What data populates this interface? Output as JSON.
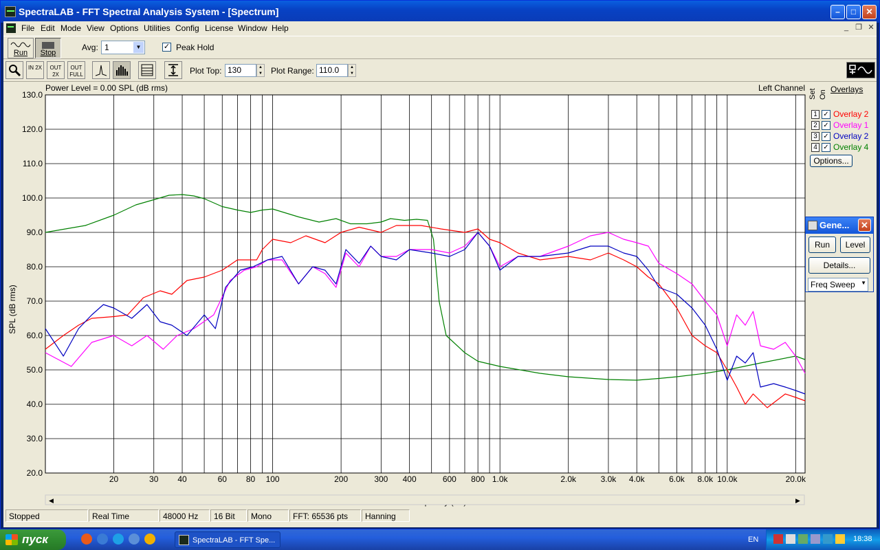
{
  "window": {
    "title": "SpectraLAB - FFT Spectral Analysis System - [Spectrum]"
  },
  "menu": [
    "File",
    "Edit",
    "Mode",
    "View",
    "Options",
    "Utilities",
    "Config",
    "License",
    "Window",
    "Help"
  ],
  "toolbar": {
    "run_label": "Run",
    "stop_label": "Stop",
    "avg_label": "Avg:",
    "avg_value": "1",
    "peak_hold_label": "Peak Hold",
    "peak_hold_checked": true,
    "zoom_in_label": "IN 2X",
    "zoom_out_label": "OUT 2X",
    "zoom_full_label": "OUT FULL",
    "plot_top_label": "Plot Top:",
    "plot_top_value": "130",
    "plot_range_label": "Plot Range:",
    "plot_range_value": "110.0"
  },
  "plot": {
    "power_level": "Power Level = 0.00 SPL (dB rms)",
    "channel": "Left Channel"
  },
  "overlays": {
    "title": "Overlays",
    "set_header": "Set",
    "on_header": "On",
    "options_label": "Options...",
    "items": [
      {
        "set": "1",
        "label": "Overlay 2",
        "color": "#ff0000",
        "checked": true
      },
      {
        "set": "2",
        "label": "Overlay 1",
        "color": "#ff00ff",
        "checked": true
      },
      {
        "set": "3",
        "label": "Overlay 2",
        "color": "#0000c0",
        "checked": true
      },
      {
        "set": "4",
        "label": "Overlay 4",
        "color": "#008000",
        "checked": true
      }
    ]
  },
  "generator": {
    "title": "Gene...",
    "run_label": "Run",
    "level_label": "Level",
    "details_label": "Details...",
    "mode_value": "Freq Sweep"
  },
  "status": {
    "state": "Stopped",
    "mode": "Real Time",
    "rate": "48000 Hz",
    "bits": "16 Bit",
    "channels": "Mono",
    "fft": "FFT: 65536 pts",
    "window": "Hanning"
  },
  "taskbar": {
    "start_label": "пуск",
    "task_label": "SpectraLAB - FFT Spe...",
    "lang": "EN",
    "clock": "18:38"
  },
  "chart_data": {
    "type": "line",
    "xlabel": "Frequency (Hz)",
    "ylabel": "SPL (dB rms)",
    "xscale": "log",
    "xlim": [
      10,
      22000
    ],
    "ylim": [
      20,
      130
    ],
    "yticks": [
      20,
      30,
      40,
      50,
      60,
      70,
      80,
      90,
      100,
      110,
      120,
      130
    ],
    "ytick_labels": [
      "20.0",
      "30.0",
      "40.0",
      "50.0",
      "60.0",
      "70.0",
      "80.0",
      "90.0",
      "100.0",
      "110.0",
      "120.0",
      "130.0"
    ],
    "xticks": [
      20,
      30,
      40,
      60,
      80,
      100,
      200,
      300,
      400,
      600,
      800,
      1000,
      2000,
      3000,
      4000,
      6000,
      8000,
      10000,
      20000
    ],
    "xtick_labels": [
      "20",
      "30",
      "40",
      "60",
      "80",
      "100",
      "200",
      "300",
      "400",
      "600",
      "800",
      "1.0k",
      "2.0k",
      "3.0k",
      "4.0k",
      "6.0k",
      "8.0k",
      "10.0k",
      "20.0k"
    ],
    "grid": true,
    "series": [
      {
        "color": "#008000",
        "points": [
          [
            10,
            90
          ],
          [
            15,
            92
          ],
          [
            20,
            95
          ],
          [
            25,
            98
          ],
          [
            30,
            99.5
          ],
          [
            35,
            100.8
          ],
          [
            40,
            101
          ],
          [
            45,
            100.6
          ],
          [
            50,
            99.8
          ],
          [
            60,
            97.5
          ],
          [
            70,
            96.5
          ],
          [
            80,
            95.8
          ],
          [
            90,
            96.5
          ],
          [
            100,
            96.8
          ],
          [
            130,
            94.5
          ],
          [
            160,
            93
          ],
          [
            190,
            94
          ],
          [
            220,
            92.5
          ],
          [
            260,
            92.5
          ],
          [
            300,
            93
          ],
          [
            330,
            94
          ],
          [
            380,
            93.5
          ],
          [
            430,
            93.8
          ],
          [
            480,
            93.5
          ],
          [
            510,
            88
          ],
          [
            540,
            70
          ],
          [
            580,
            60
          ],
          [
            700,
            55
          ],
          [
            800,
            52.5
          ],
          [
            1000,
            51
          ],
          [
            1500,
            49
          ],
          [
            2000,
            48
          ],
          [
            3000,
            47.2
          ],
          [
            4000,
            47
          ],
          [
            5000,
            47.5
          ],
          [
            6000,
            48
          ],
          [
            8000,
            49
          ],
          [
            10000,
            50
          ],
          [
            14000,
            52
          ],
          [
            20000,
            54
          ],
          [
            22000,
            53
          ]
        ]
      },
      {
        "color": "#ff0000",
        "points": [
          [
            10,
            56
          ],
          [
            12,
            60
          ],
          [
            14,
            63
          ],
          [
            16,
            65
          ],
          [
            20,
            65.5
          ],
          [
            23,
            66
          ],
          [
            27,
            71
          ],
          [
            32,
            73
          ],
          [
            36,
            72
          ],
          [
            42,
            76
          ],
          [
            50,
            77
          ],
          [
            60,
            79
          ],
          [
            70,
            82
          ],
          [
            85,
            82
          ],
          [
            90,
            85
          ],
          [
            100,
            88
          ],
          [
            120,
            87
          ],
          [
            140,
            89
          ],
          [
            170,
            87
          ],
          [
            200,
            90
          ],
          [
            240,
            91.5
          ],
          [
            300,
            90
          ],
          [
            350,
            92
          ],
          [
            450,
            92
          ],
          [
            550,
            91
          ],
          [
            700,
            90
          ],
          [
            800,
            91
          ],
          [
            900,
            88
          ],
          [
            1000,
            87
          ],
          [
            1200,
            84
          ],
          [
            1500,
            82
          ],
          [
            2000,
            83
          ],
          [
            2500,
            82
          ],
          [
            3000,
            84
          ],
          [
            3500,
            82
          ],
          [
            4000,
            80
          ],
          [
            4500,
            77
          ],
          [
            5000,
            75
          ],
          [
            6000,
            68
          ],
          [
            7000,
            60
          ],
          [
            8000,
            57
          ],
          [
            9000,
            55
          ],
          [
            10000,
            50
          ],
          [
            11000,
            45
          ],
          [
            12000,
            40
          ],
          [
            13000,
            43
          ],
          [
            15000,
            39
          ],
          [
            18000,
            43
          ],
          [
            20000,
            42
          ],
          [
            22000,
            41
          ]
        ]
      },
      {
        "color": "#ff00ff",
        "points": [
          [
            10,
            55
          ],
          [
            13,
            51
          ],
          [
            16,
            58
          ],
          [
            20,
            60
          ],
          [
            24,
            57
          ],
          [
            28,
            60
          ],
          [
            33,
            56
          ],
          [
            38,
            60
          ],
          [
            45,
            62
          ],
          [
            55,
            66
          ],
          [
            65,
            76
          ],
          [
            75,
            79
          ],
          [
            85,
            80
          ],
          [
            95,
            82
          ],
          [
            110,
            82
          ],
          [
            130,
            75
          ],
          [
            150,
            80
          ],
          [
            170,
            78
          ],
          [
            190,
            74
          ],
          [
            210,
            84
          ],
          [
            240,
            80
          ],
          [
            270,
            86
          ],
          [
            300,
            83
          ],
          [
            350,
            83
          ],
          [
            400,
            85
          ],
          [
            500,
            85
          ],
          [
            600,
            84
          ],
          [
            700,
            86
          ],
          [
            800,
            90
          ],
          [
            900,
            86
          ],
          [
            1000,
            80
          ],
          [
            1200,
            83
          ],
          [
            1500,
            83
          ],
          [
            2000,
            86
          ],
          [
            2500,
            89
          ],
          [
            3000,
            90
          ],
          [
            3500,
            88
          ],
          [
            4000,
            87
          ],
          [
            4500,
            86
          ],
          [
            5000,
            81
          ],
          [
            6000,
            78
          ],
          [
            7000,
            75
          ],
          [
            8000,
            70
          ],
          [
            9000,
            66
          ],
          [
            10000,
            57
          ],
          [
            11000,
            66
          ],
          [
            12000,
            63
          ],
          [
            13000,
            67
          ],
          [
            14000,
            57
          ],
          [
            16000,
            56
          ],
          [
            18000,
            58
          ],
          [
            20000,
            54
          ],
          [
            22000,
            49
          ]
        ]
      },
      {
        "color": "#0000c0",
        "points": [
          [
            10,
            62
          ],
          [
            12,
            54
          ],
          [
            14,
            62
          ],
          [
            16,
            66
          ],
          [
            18,
            69
          ],
          [
            20,
            68
          ],
          [
            24,
            65
          ],
          [
            28,
            69
          ],
          [
            32,
            64
          ],
          [
            36,
            63
          ],
          [
            42,
            60
          ],
          [
            50,
            66
          ],
          [
            56,
            62
          ],
          [
            62,
            74
          ],
          [
            72,
            79
          ],
          [
            82,
            80
          ],
          [
            95,
            82
          ],
          [
            110,
            83
          ],
          [
            130,
            75
          ],
          [
            150,
            80
          ],
          [
            170,
            79
          ],
          [
            190,
            75
          ],
          [
            210,
            85
          ],
          [
            240,
            81
          ],
          [
            270,
            86
          ],
          [
            300,
            83
          ],
          [
            350,
            82
          ],
          [
            400,
            85
          ],
          [
            500,
            84
          ],
          [
            600,
            83
          ],
          [
            700,
            85
          ],
          [
            800,
            90
          ],
          [
            900,
            86
          ],
          [
            1000,
            79
          ],
          [
            1200,
            83
          ],
          [
            1500,
            83
          ],
          [
            2000,
            84
          ],
          [
            2500,
            86
          ],
          [
            3000,
            86
          ],
          [
            3500,
            84
          ],
          [
            4000,
            83
          ],
          [
            4500,
            79
          ],
          [
            5000,
            74
          ],
          [
            6000,
            72
          ],
          [
            7000,
            68
          ],
          [
            8000,
            63
          ],
          [
            9000,
            56
          ],
          [
            10000,
            47
          ],
          [
            11000,
            54
          ],
          [
            12000,
            52
          ],
          [
            13000,
            55
          ],
          [
            14000,
            45
          ],
          [
            16000,
            46
          ],
          [
            18000,
            45
          ],
          [
            20000,
            44
          ],
          [
            22000,
            43
          ]
        ]
      }
    ]
  }
}
